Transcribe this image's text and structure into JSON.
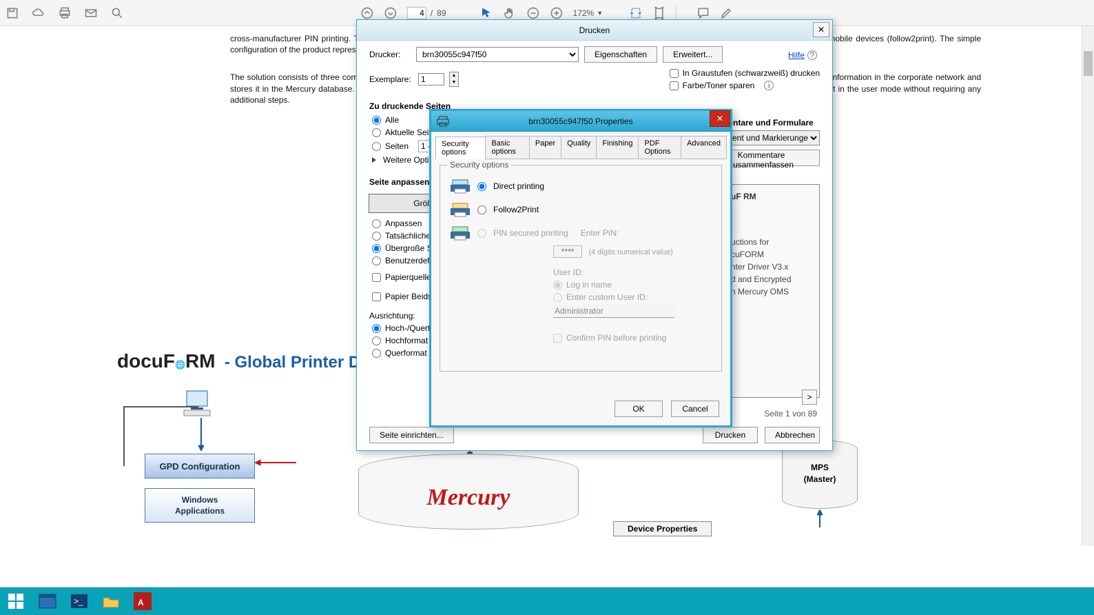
{
  "toolbar": {
    "page_current": "4",
    "page_total": "89",
    "page_sep": "/",
    "zoom_value": "172%"
  },
  "document": {
    "para1": "cross-manufacturer PIN printing. The connection to the Mercury server ensures network-wide distribution of device configurations, as well as cloud printing via mobile devices (follow2print). The simple configuration of the product represents the unique selling point of the GPD concept.",
    "para2": "The solution consists of three components of which the Mercury Server is the core piece. In addition to all print jobs, the Mercury platform also collects all device information in the corporate network and stores it in the Mercury database. MSI the second component is installed at each workstation. With this installation, finally, the setup of the GPD can be carried out in the user mode without requiring any additional steps.",
    "logo_text": "docuF RM",
    "diagram_title": "- Global Printer Driver",
    "box_config": "GPD Configuration",
    "box_winapp": "Windows\nApplications",
    "mercury_label": "Mercury",
    "mps_line1": "MPS",
    "mps_line2": "(Master)",
    "device_props_box": "Device Properties"
  },
  "print": {
    "title": "Drucken",
    "close": "✕",
    "lbl_printer": "Drucker:",
    "printer_value": "brn30055c947f50",
    "btn_props": "Eigenschaften",
    "btn_advanced": "Erweitert...",
    "help": "Hilfe",
    "lbl_copies": "Exemplare:",
    "copies_value": "1",
    "chk_grayscale": "In Graustufen (schwarzweiß) drucken",
    "chk_savetoner": "Farbe/Toner sparen",
    "sec_pages": "Zu druckende Seiten",
    "r_all": "Alle",
    "r_current": "Aktuelle Seite",
    "r_range": "Seiten",
    "range_value": "1 -",
    "more_opts": "Weitere Optionen",
    "sec_fit": "Seite anpassen und Optionen",
    "btn_size": "Größe",
    "r_fit": "Anpassen",
    "r_actual": "Tatsächliche Größe",
    "r_oversize": "Übergroße Seiten verkleinern",
    "r_custom": "Benutzerdefinierter Maßstab",
    "chk_source": "Papierquelle gemäß PDF-Seitengröße auswählen",
    "chk_duplex": "Papier Beidseitig bedrucken",
    "lbl_orient": "Ausrichtung:",
    "r_auto": "Hoch-/Querformat automatisch",
    "r_portrait": "Hochformat",
    "r_landscape": "Querformat",
    "sec_comments": "Kommentare und Formulare",
    "comments_value": "Dokument und Markierungen",
    "btn_summarize": "Kommentare zusammenfassen",
    "preview_l1": "uctions for",
    "preview_l2": "cuFORM",
    "preview_l3": "nter Driver V3.x",
    "preview_l4": "d and Encrypted",
    "preview_l5": "n Mercury OMS",
    "preview_logo": "uF   RM",
    "page_info": "Seite 1 von 89",
    "btn_pagesetup": "Seite einrichten...",
    "btn_print": "Drucken",
    "btn_cancel": "Abbrechen",
    "next_pg": ">"
  },
  "props": {
    "title": "brn30055c947f50 Properties",
    "close": "✕",
    "tabs": [
      "Security options",
      "Basic options",
      "Paper",
      "Quality",
      "Finishing",
      "PDF Options",
      "Advanced"
    ],
    "fieldset": "Security options",
    "opt_direct": "Direct printing",
    "opt_follow": "Follow2Print",
    "opt_pin": "PIN secured printing",
    "lbl_enterpin": "Enter PIN:",
    "pin_placeholder": "****",
    "pin_hint": "(4 digits numerical value)",
    "lbl_userid": "User ID:",
    "r_login": "Log in name",
    "r_custom": "Enter custom User ID:",
    "custom_value": "Administrator",
    "chk_confirm": "Confirm PIN before printing",
    "btn_ok": "OK",
    "btn_cancel": "Cancel"
  },
  "taskbar": {
    "items": [
      "start",
      "explorer",
      "powershell",
      "files",
      "adobe"
    ]
  }
}
